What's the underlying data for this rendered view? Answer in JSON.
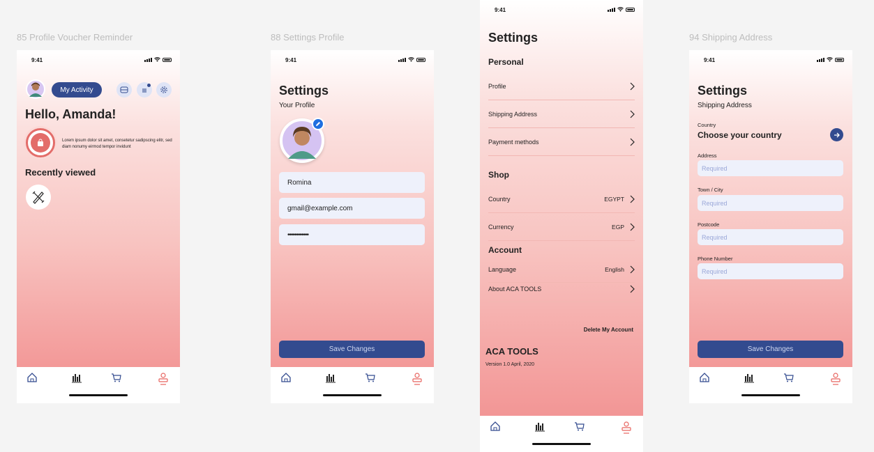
{
  "frames": [
    {
      "label": "85 Profile Voucher Reminder"
    },
    {
      "label": "88 Settings Profile"
    },
    {
      "label": "Settings main"
    },
    {
      "label": "94 Shipping Address"
    }
  ],
  "status_bar": {
    "time": "9:41"
  },
  "profile_voucher": {
    "activity_button": "My Activity",
    "greeting": "Hello, Amanda!",
    "voucher_text": "Lorem ipsum dolor sit amet, consetetur sadipscing elitr, sed diam nonumy eirmod tempor invidunt",
    "recently_viewed": "Recently viewed"
  },
  "settings_profile": {
    "title": "Settings",
    "subtitle": "Your Profile",
    "name_value": "Romina",
    "email_value": "gmail@example.com",
    "password_value": "••••••••••••",
    "save_label": "Save Changes"
  },
  "settings_main": {
    "title": "Settings",
    "personal_header": "Personal",
    "personal_items": [
      {
        "label": "Profile"
      },
      {
        "label": "Shipping Address"
      },
      {
        "label": "Payment methods"
      }
    ],
    "shop_header": "Shop",
    "shop_items": [
      {
        "label": "Country",
        "value": "EGYPT"
      },
      {
        "label": "Currency",
        "value": "EGP"
      }
    ],
    "account_header": "Account",
    "account_items": [
      {
        "label": "Language",
        "value": "English"
      },
      {
        "label": "About ACA TOOLS",
        "value": ""
      }
    ],
    "delete_label": "Delete My Account",
    "brand": "ACA TOOLS",
    "version": "Version 1.0 April, 2020"
  },
  "shipping": {
    "title": "Settings",
    "subtitle": "Shipping Address",
    "country_label": "Country",
    "country_value": "Choose your country",
    "address_label": "Address",
    "town_label": "Town / City",
    "postcode_label": "Postcode",
    "phone_label": "Phone Number",
    "placeholder": "Required",
    "save_label": "Save Changes"
  },
  "colors": {
    "accent": "#334b8f",
    "input_bg": "#eef1fb",
    "active_tab": "#e8645f",
    "gradient_bottom": "#f18c8c"
  }
}
